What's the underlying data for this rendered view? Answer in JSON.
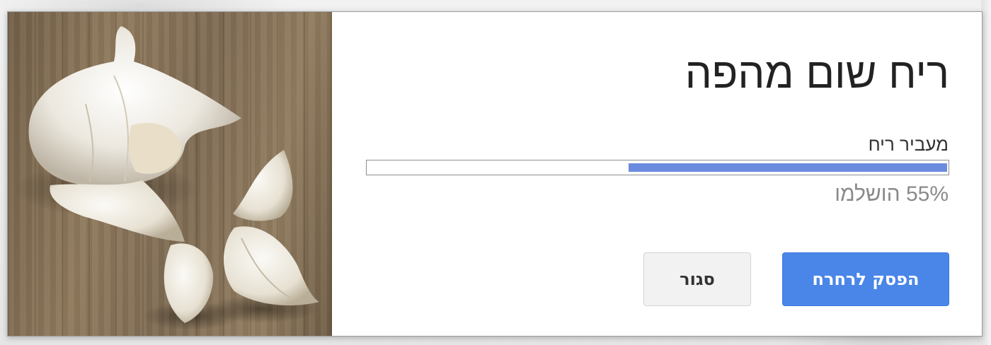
{
  "dialog": {
    "title": "ריח שום מהפה",
    "status_label": "מעביר ריח",
    "progress": {
      "fraction": 0.55,
      "fill_color": "#6b8bdf"
    },
    "percent_text": "55% הושלמו",
    "image_icon": "garlic-photo",
    "buttons": {
      "stop_label": "הפסק לרחרח",
      "close_label": "סגור"
    },
    "colors": {
      "primary": "#4a86e8",
      "secondary": "#f2f2f2"
    }
  }
}
